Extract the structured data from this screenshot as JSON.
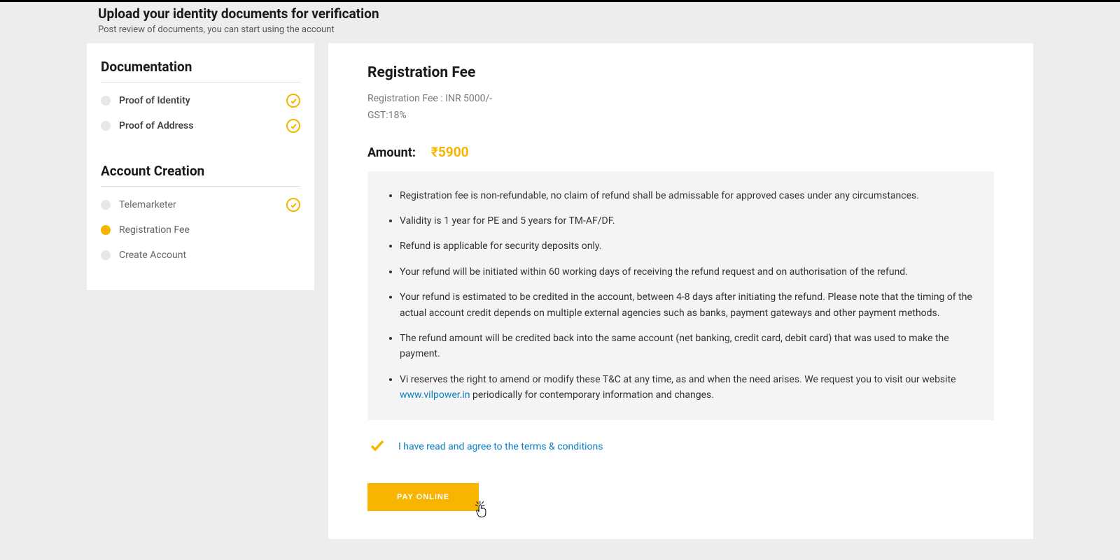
{
  "header": {
    "title": "Upload your identity documents for verification",
    "subtitle": "Post review of documents, you can start using the account"
  },
  "sidebar": {
    "sections": [
      {
        "title": "Documentation",
        "items": [
          {
            "label": "Proof of Identity",
            "completed": true,
            "active": false
          },
          {
            "label": "Proof of Address",
            "completed": true,
            "active": false
          }
        ]
      },
      {
        "title": "Account Creation",
        "items": [
          {
            "label": "Telemarketer",
            "completed": true,
            "active": false
          },
          {
            "label": "Registration Fee",
            "completed": false,
            "active": true
          },
          {
            "label": "Create Account",
            "completed": false,
            "active": false
          }
        ]
      }
    ]
  },
  "main": {
    "title": "Registration Fee",
    "fee_line": "Registration Fee : INR 5000/-",
    "gst_line": "GST:18%",
    "amount_label": "Amount:",
    "amount_value": "₹5900",
    "terms": [
      "Registration fee is non-refundable, no claim of refund shall be admissable for approved cases under any circumstances.",
      "Validity is 1 year for PE and 5 years for TM-AF/DF.",
      "Refund is applicable for security deposits only.",
      "Your refund will be initiated within 60 working days of receiving the refund request and on authorisation of the refund.",
      "Your refund is estimated to be credited in the account, between 4-8 days after initiating the refund. Please note that the timing of the actual account credit depends on multiple external agencies such as banks, payment gateways and other payment methods.",
      "The refund amount will be credited back into the same account (net banking, credit card, debit card) that was used to make the payment."
    ],
    "terms_last_prefix": "Vi reserves the right to amend or modify these T&C at any time, as and when the need arises. We request you to visit our website ",
    "terms_last_link": "www.vilpower.in",
    "terms_last_suffix": " periodically for contemporary information and changes.",
    "agree_text": "I have read and agree to the terms & conditions",
    "pay_label": "PAY ONLINE"
  }
}
